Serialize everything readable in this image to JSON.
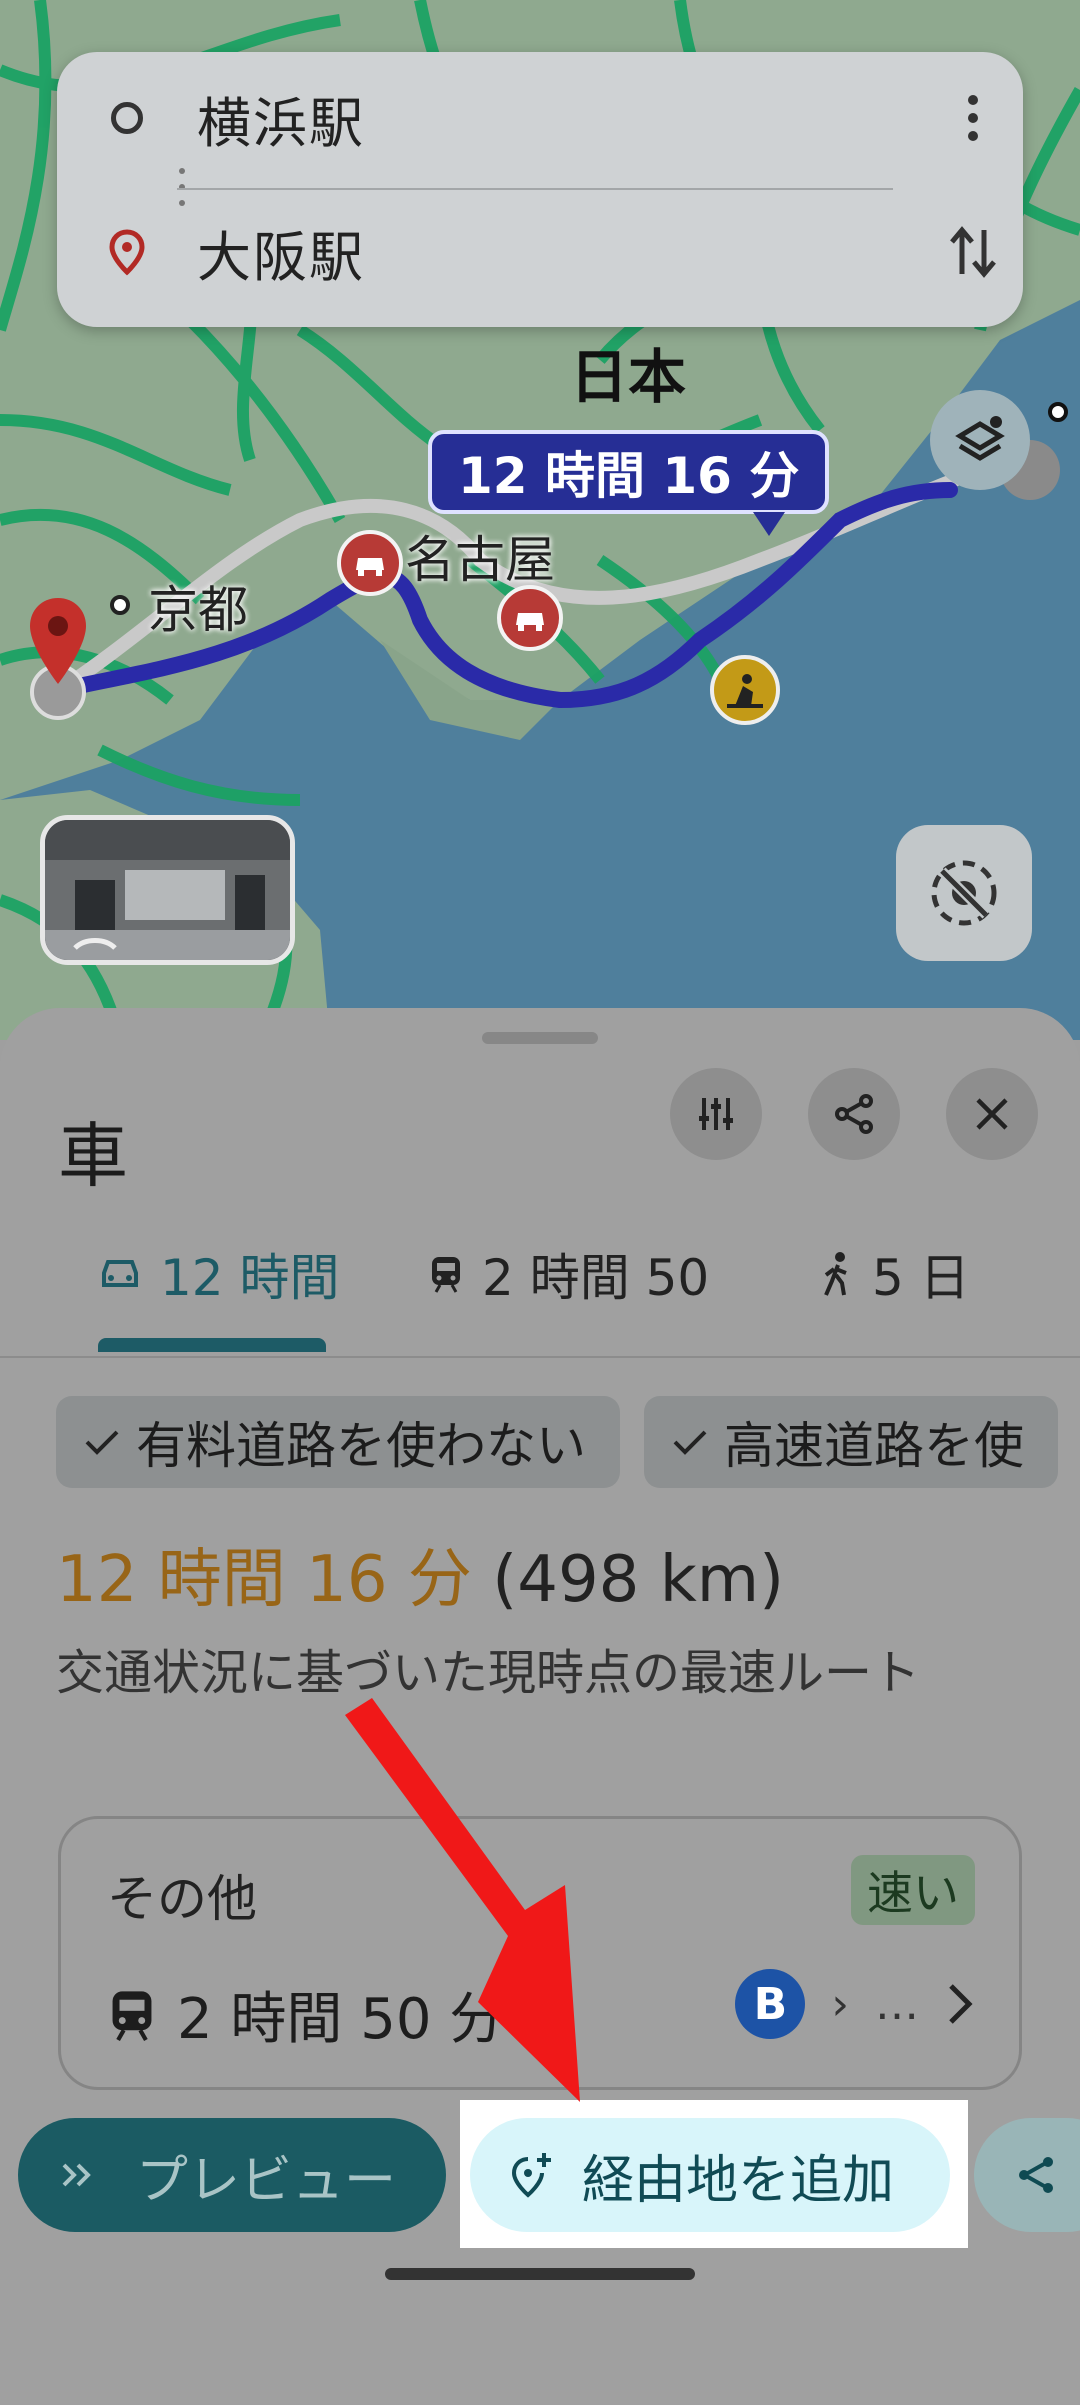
{
  "search": {
    "origin": "横浜駅",
    "destination": "大阪駅"
  },
  "map": {
    "country_label": "日本",
    "city_nagoya": "名古屋",
    "city_kyoto": "京都",
    "route_duration_bubble": "12 時間 16 分",
    "colors": {
      "route": "#2a2aa8",
      "roads": "#1aa060",
      "water": "#4a7fa0",
      "land": "#8ea88f"
    }
  },
  "sheet": {
    "title": "車",
    "tabs": [
      {
        "label": "12 時間",
        "icon": "car-icon",
        "active": true
      },
      {
        "label": "2 時間 50",
        "icon": "train-icon",
        "active": false
      },
      {
        "label": "5 日",
        "icon": "walk-icon",
        "active": false
      }
    ],
    "chips": [
      {
        "label": "有料道路を使わない",
        "icon": "check-icon"
      },
      {
        "label": "高速道路を使",
        "icon": "check-icon"
      }
    ],
    "route_time": "12 時間 16 分",
    "route_distance": "(498 km)",
    "route_description": "交通状況に基づいた現時点の最速ルート",
    "other": {
      "title": "その他",
      "badge": "速い",
      "transit_time": "2 時間 50 分",
      "route_badge": "B",
      "route_more": "…"
    },
    "actions": {
      "preview": "プレビュー",
      "add_waypoint": "経由地を追加"
    }
  }
}
